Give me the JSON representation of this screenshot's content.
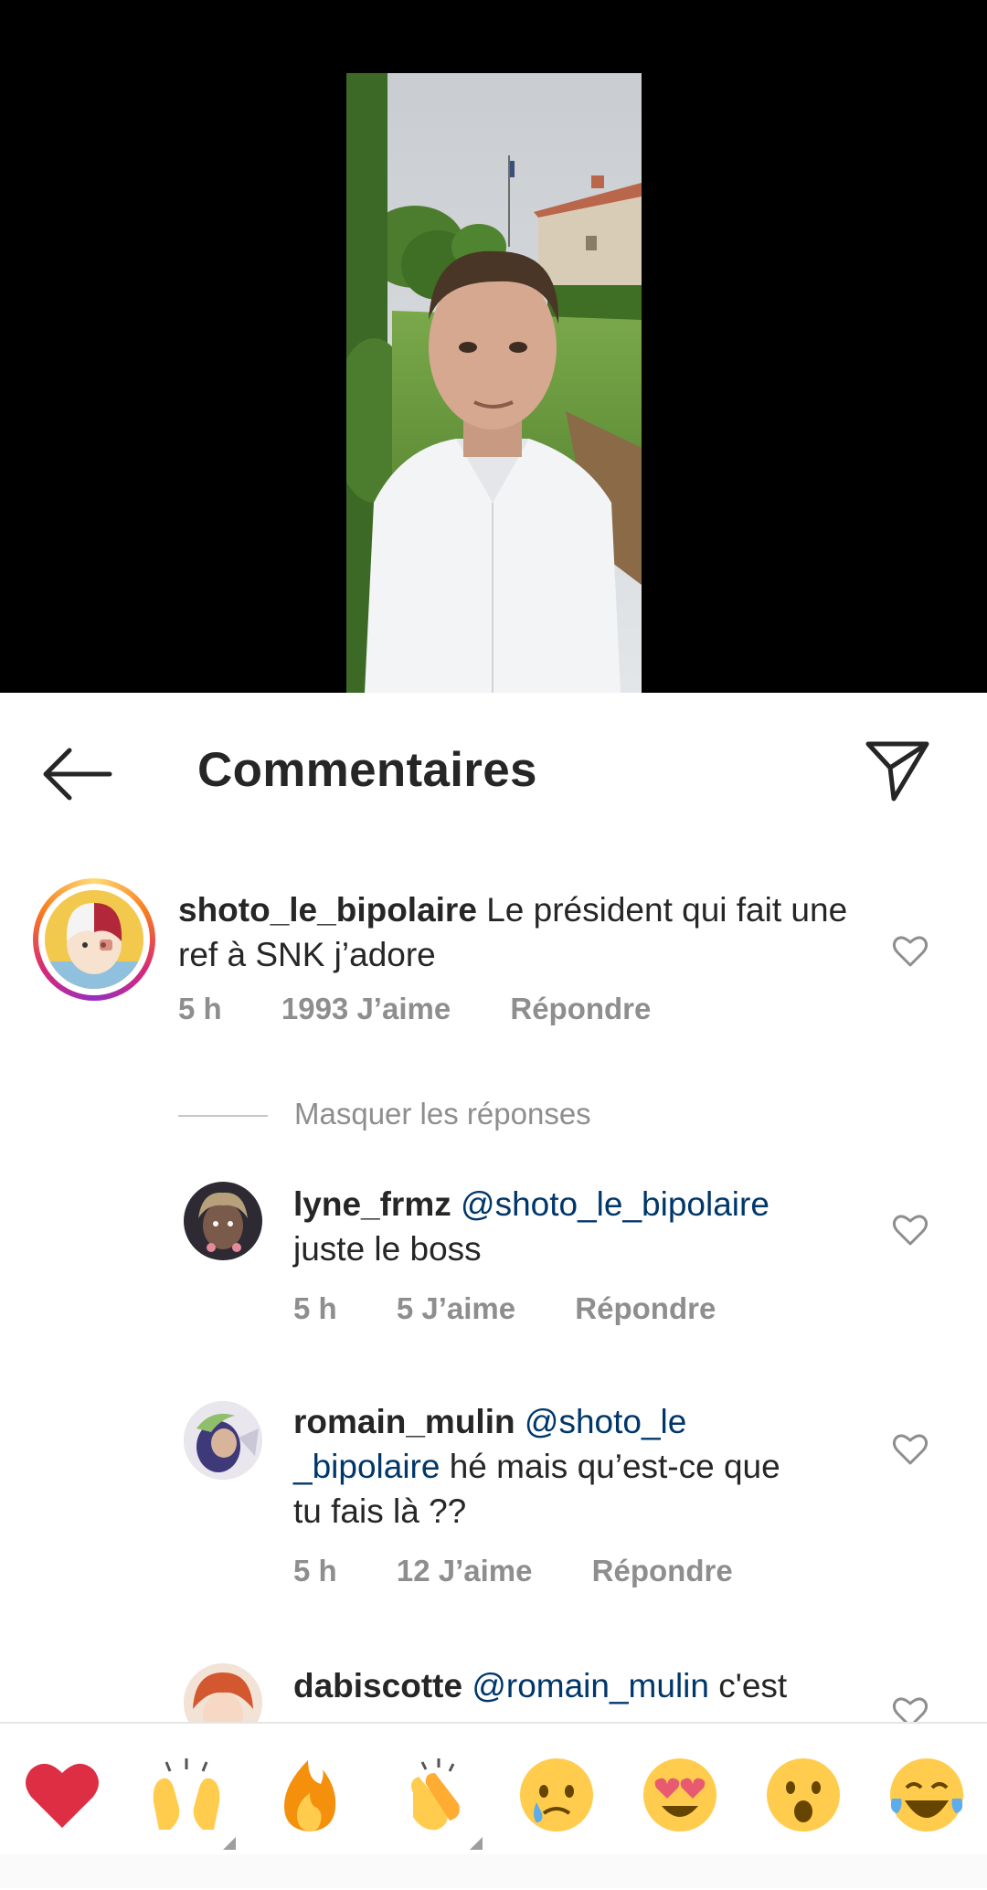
{
  "video": {
    "description_icon": "video-thumbnail"
  },
  "header": {
    "title": "Commentaires",
    "back_icon": "arrow-left-icon",
    "share_icon": "paper-plane-icon"
  },
  "comments": [
    {
      "username": "shoto_le_bipolaire",
      "text": " Le président qui fait une ref à SNK j’adore",
      "time": "5 h",
      "likes": "1993 J’aime",
      "reply": "Répondre"
    }
  ],
  "hide_replies": "Masquer les réponses",
  "replies": [
    {
      "username": "lyne_frmz",
      "mention": "@shoto_le_bipolaire",
      "text": "juste le boss",
      "time": "5 h",
      "likes": "5 J’aime",
      "reply": "Répondre"
    },
    {
      "username": "romain_mulin",
      "mention_part1": "@shoto_le",
      "mention_part2": "_bipolaire",
      "text_line2_suffix": " hé mais qu’est-ce que",
      "text_line3": "tu fais là ??",
      "time": "5 h",
      "likes": "12 J’aime",
      "reply": "Répondre"
    },
    {
      "username": "dabiscotte",
      "mention": "@romain_mulin",
      "text": " c'est"
    }
  ],
  "emoji_bar": [
    {
      "name": "red-heart",
      "has_variants": false
    },
    {
      "name": "raising-hands",
      "has_variants": true
    },
    {
      "name": "fire",
      "has_variants": false
    },
    {
      "name": "clapping-hands",
      "has_variants": true
    },
    {
      "name": "crying-face",
      "has_variants": false
    },
    {
      "name": "heart-eyes-face",
      "has_variants": false
    },
    {
      "name": "astonished-face",
      "has_variants": false
    },
    {
      "name": "tears-of-joy-face",
      "has_variants": false
    }
  ],
  "colors": {
    "text": "#262626",
    "secondary": "#8e8e8e",
    "mention": "#00376b",
    "background": "#ffffff",
    "video_bg": "#000000"
  }
}
